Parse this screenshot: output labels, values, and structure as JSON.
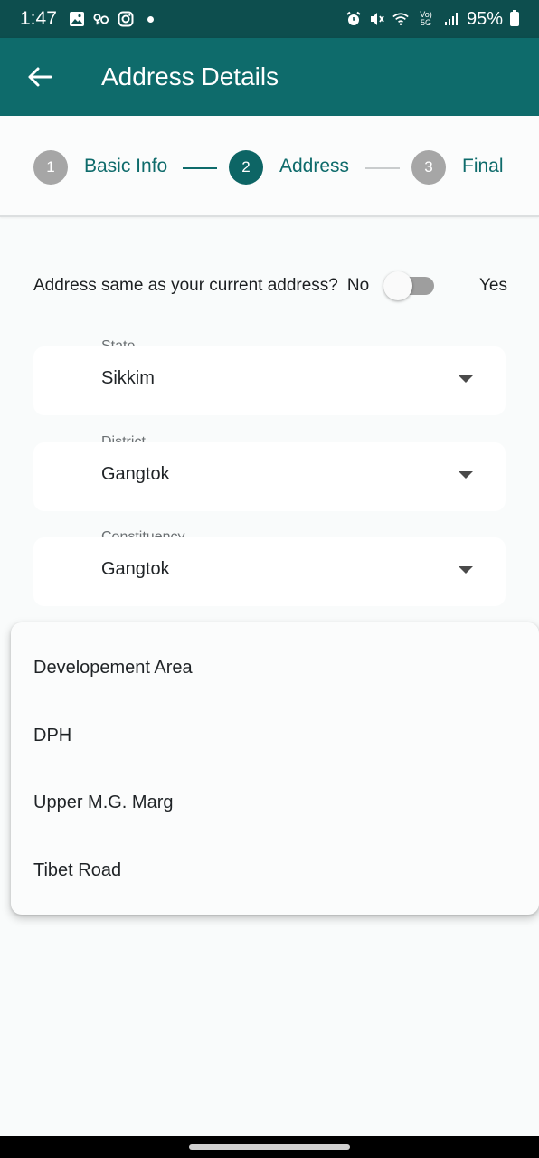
{
  "status_bar": {
    "time": "1:47",
    "battery": "95%",
    "icons_left": [
      "gallery-icon",
      "key-icon",
      "instagram-icon",
      "notification-dot"
    ],
    "icons_right": [
      "alarm-icon",
      "mute-icon",
      "wifi-icon",
      "volte-5g-icon",
      "signal-icon",
      "battery-icon"
    ]
  },
  "app_bar": {
    "title": "Address Details",
    "color": "#0e6b6b"
  },
  "stepper": {
    "steps": [
      {
        "number": "1",
        "label": "Basic Info",
        "state": "completed"
      },
      {
        "number": "2",
        "label": "Address",
        "state": "active"
      },
      {
        "number": "3",
        "label": "Final",
        "state": "pending"
      }
    ]
  },
  "address_toggle": {
    "question": "Address same as your current address?",
    "no_label": "No",
    "yes_label": "Yes",
    "value": false
  },
  "fields": {
    "state": {
      "label": "State",
      "value": "Sikkim"
    },
    "district": {
      "label": "District",
      "value": "Gangtok"
    },
    "constituency": {
      "label": "Constituency",
      "value": "Gangtok"
    }
  },
  "dropdown_menu": {
    "options": [
      "Developement Area",
      "DPH",
      "Upper M.G. Marg",
      "Tibet Road"
    ]
  },
  "colors": {
    "primary": "#0e6b6b",
    "status_bar": "#0d4e4e",
    "inactive_step": "#a6a6a6",
    "background": "#f9fbfb"
  }
}
